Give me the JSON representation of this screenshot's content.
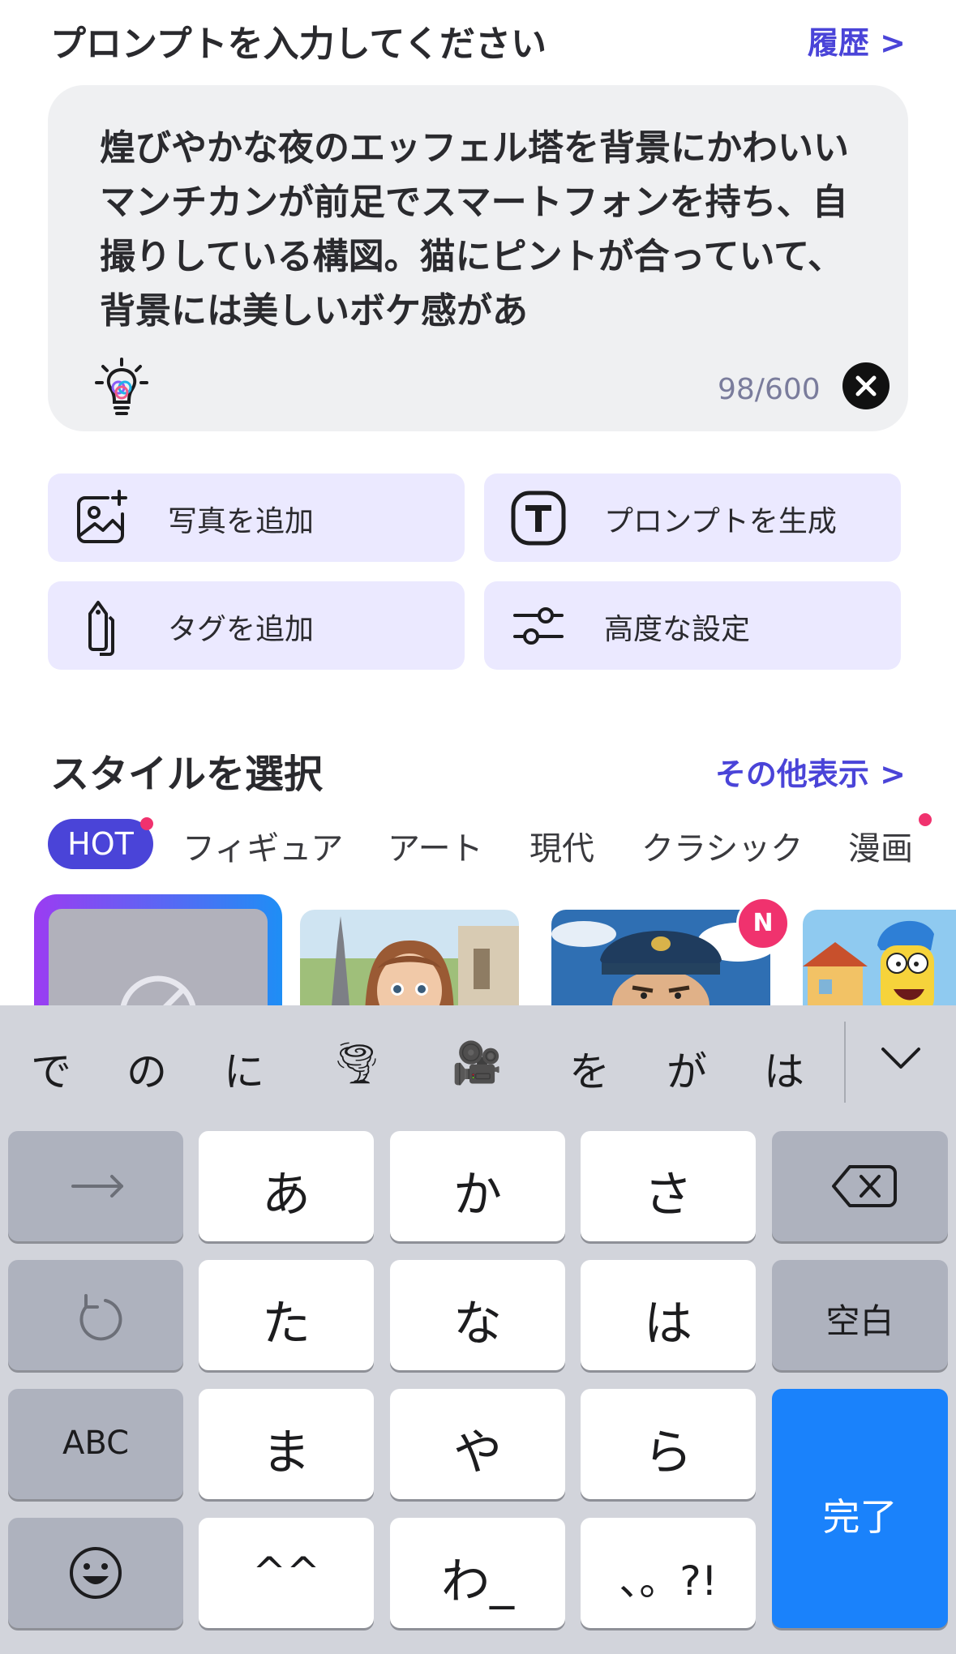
{
  "header": {
    "title": "プロンプトを入力してください",
    "history_link": "履歴 >"
  },
  "prompt": {
    "text": "煌びやかな夜のエッフェル塔を背景にかわいいマンチカンが前足でスマートフォンを持ち、自撮りしている構図。猫にピントが合っていて、背景には美しいボケ感があ",
    "counter": "98/600"
  },
  "actions": {
    "add_photo": "写真を追加",
    "generate_prompt": "プロンプトを生成",
    "add_tag": "タグを追加",
    "advanced": "高度な設定"
  },
  "style": {
    "title": "スタイルを選択",
    "more_link": "その他表示 >",
    "tabs": [
      "HOT",
      "フィギュア",
      "アート",
      "現代",
      "クラシック",
      "漫画"
    ],
    "new_badge": "N"
  },
  "keyboard": {
    "suggestions": [
      "で",
      "の",
      "に",
      "🌪",
      "🎥",
      "を",
      "が",
      "は"
    ],
    "keys": {
      "a": "あ",
      "ka": "か",
      "sa": "さ",
      "ta": "た",
      "na": "な",
      "ha": "は",
      "space": "空白",
      "abc": "ABC",
      "ma": "ま",
      "ya": "や",
      "ra": "ら",
      "kaomoji": "^^",
      "wa": "わ_",
      "punct": "、。?!",
      "done": "完了"
    }
  },
  "colors": {
    "accent": "#4a44d8",
    "action_bg": "#ebe9ff",
    "badge": "#f0326e",
    "key_blue": "#1a82fb"
  }
}
